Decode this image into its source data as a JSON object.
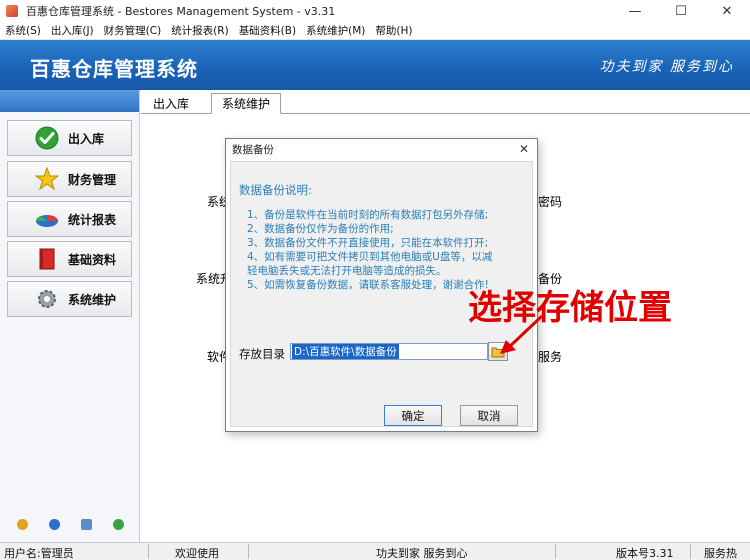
{
  "window": {
    "title": "百惠仓库管理系统 - Bestores Management System - v3.31",
    "minimize_icon": "minimize-icon",
    "maximize_icon": "maximize-icon",
    "close_icon": "close-icon"
  },
  "menu": {
    "items": [
      "系统(S)",
      "出入库(J)",
      "财务管理(C)",
      "统计报表(R)",
      "基础资料(B)",
      "系统维护(M)",
      "帮助(H)"
    ]
  },
  "banner": {
    "title": "百惠仓库管理系统",
    "slogan": "功夫到家  服务到心"
  },
  "sidebar": {
    "items": [
      {
        "label": "出入库",
        "icon": "check-circle-icon"
      },
      {
        "label": "财务管理",
        "icon": "star-icon"
      },
      {
        "label": "统计报表",
        "icon": "pie-chart-icon"
      },
      {
        "label": "基础资料",
        "icon": "book-icon"
      },
      {
        "label": "系统维护",
        "icon": "gear-icon"
      }
    ],
    "bottom_icons": [
      "key-icon",
      "clock-icon",
      "monitor-icon",
      "refresh-icon"
    ]
  },
  "tabs": [
    {
      "label": "出入库",
      "active": false
    },
    {
      "label": "系统维护",
      "active": true
    }
  ],
  "background_labels": {
    "left_top": "系统",
    "left_mid": "系统升",
    "left_bottom": "软件",
    "right_top": "密码",
    "right_mid": "备份",
    "right_bottom": "服务"
  },
  "dialog": {
    "title": "数据备份",
    "heading": "数据备份说明:",
    "lines": [
      "1、备份是软件在当前时刻的所有数据打包另外存储;",
      "2、数据备份仅作为备份的作用;",
      "3、数据备份文件不开直接使用，只能在本软件打开;",
      "4、如有需要可把文件拷贝到其他电脑或U盘等，以减",
      "    轻电脑丢失或无法打开电脑等造成的损失。",
      "5、如需恢复备份数据，请联系客服处理，谢谢合作!"
    ],
    "dir_label": "存放目录",
    "dir_value": "D:\\百惠软件\\数据备份",
    "ok_label": "确定",
    "cancel_label": "取消"
  },
  "annotation": "选择存储位置",
  "status": {
    "user": "用户名:管理员",
    "welcome": "欢迎使用",
    "slogan": "功夫到家 服务到心",
    "version": "版本号3.31",
    "service": "服务热"
  },
  "colors": {
    "banner": "#1a64b8",
    "annotation": "#e00000",
    "dialog_text": "#2a7fb8",
    "selection": "#1a66c9"
  }
}
